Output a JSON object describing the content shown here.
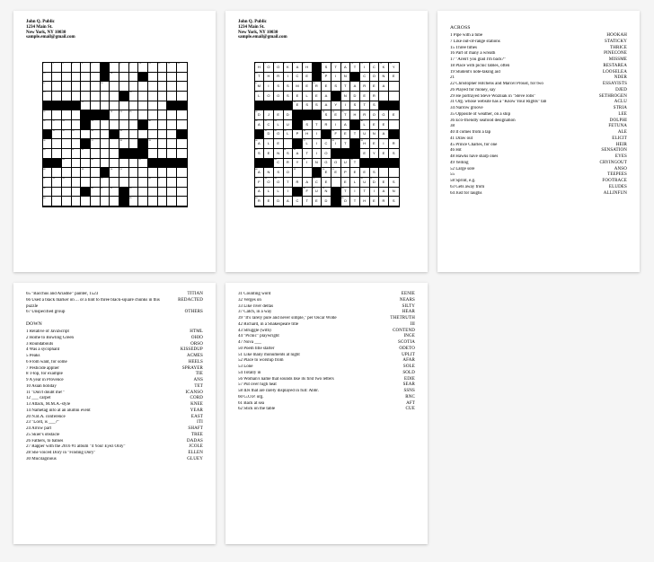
{
  "header": {
    "name": "John Q. Public",
    "street": "1234 Main St.",
    "city": "New York, NY 10030",
    "email": "sample.email@gmail.com"
  },
  "sections": {
    "across": "ACROSS",
    "down": "DOWN"
  },
  "across": [
    {
      "n": "1",
      "t": "Pipe with a tube",
      "a": "HOOKAH"
    },
    {
      "n": "7",
      "t": "Like out-of-range stations",
      "a": "STATICKY"
    },
    {
      "n": "15",
      "t": "Three times",
      "a": "THRICE"
    },
    {
      "n": "16",
      "t": "Part of many a wreath",
      "a": "PINECONE"
    },
    {
      "n": "17",
      "t": "\"Aren't you glad I'm back?\"",
      "a": "MISSME"
    },
    {
      "n": "18",
      "t": "Place with picnic tables, often",
      "a": "RESTAREA"
    },
    {
      "n": "19",
      "t": "Student's note-taking aid",
      "a": "LOOSELEA"
    },
    {
      "n": "21",
      "t": "",
      "a": "NDER"
    },
    {
      "n": "22",
      "t": "Christopher Hitchens and Marcel Proust, for two",
      "a": "ESSAYISTS"
    },
    {
      "n": "26",
      "t": "Played for money, say",
      "a": "DJED"
    },
    {
      "n": "29",
      "t": "He portrayed Steve Wozniak in \"Steve Jobs\"",
      "a": "SETHROGEN"
    },
    {
      "n": "31",
      "t": "Org. whose website has a \"Know Your Rights\" tab",
      "a": "ACLU"
    },
    {
      "n": "34",
      "t": "Narrow groove",
      "a": "STRIA"
    },
    {
      "n": "35",
      "t": "Opposite of weather, on a ship",
      "a": "LEE"
    },
    {
      "n": "36",
      "t": "Eco-friendly seafood designation",
      "a": "DOLPHI"
    },
    {
      "n": "38",
      "t": "",
      "a": "FETUNA"
    },
    {
      "n": "40",
      "t": "It comes from a tap",
      "a": "ALE"
    },
    {
      "n": "41",
      "t": "Draw out",
      "a": "ELICIT"
    },
    {
      "n": "45",
      "t": "Prince Charles, for one",
      "a": "HEIR"
    },
    {
      "n": "46",
      "t": "Hit",
      "a": "SENSATION"
    },
    {
      "n": "48",
      "t": "Hawks have sharp ones",
      "a": "EYES"
    },
    {
      "n": "49",
      "t": "Yelling",
      "a": "CRYINGOUT"
    },
    {
      "n": "52",
      "t": "Large sore",
      "a": "ANSO"
    },
    {
      "n": "55",
      "t": "",
      "a": "TEEPEES"
    },
    {
      "n": "58",
      "t": "Sprint, e.g.",
      "a": "FOOTRACE"
    },
    {
      "n": "63",
      "t": "Gets away from",
      "a": "ELUDES"
    },
    {
      "n": "64",
      "t": "Just for laughs",
      "a": "ALLINFUN"
    }
  ],
  "across2": [
    {
      "n": "65",
      "t": "\"Bacchus and Ariadne\" painter, 1523",
      "a": "TITIAN"
    },
    {
      "n": "66",
      "t": "Used a black marker on ... or a hint to three black-square chunks in this puzzle",
      "a": "REDACTED"
    },
    {
      "n": "67",
      "t": "Unspecified group",
      "a": "OTHERS"
    }
  ],
  "down": [
    {
      "n": "1",
      "t": "Relative of JavaScript",
      "a": "HTML"
    },
    {
      "n": "2",
      "t": "Home to Bowling Green",
      "a": "OHIO"
    },
    {
      "n": "3",
      "t": "Roundabouts",
      "a": "ORSO"
    },
    {
      "n": "4",
      "t": "Was a sycophant",
      "a": "KISSEDUP"
    },
    {
      "n": "5",
      "t": "Peaks",
      "a": "ACMES"
    },
    {
      "n": "6",
      "t": "From want, for some",
      "a": "HEELS"
    },
    {
      "n": "7",
      "t": "Pesticide applier",
      "a": "SPRAYER"
    },
    {
      "n": "8",
      "t": "T-top, for example",
      "a": "TIE"
    },
    {
      "n": "9",
      "t": "A year in Provence",
      "a": "ANS"
    },
    {
      "n": "10",
      "t": "Asian holiday",
      "a": "TET"
    },
    {
      "n": "11",
      "t": "\"Don't doubt me!\"",
      "a": "ICANSO"
    },
    {
      "n": "12",
      "t": "___ carpet",
      "a": "CORD"
    },
    {
      "n": "13",
      "t": "Attack, M.M.A.-style",
      "a": "KNEE"
    },
    {
      "n": "14",
      "t": "Nametag info at an alumni event",
      "a": "YEAR"
    },
    {
      "n": "20",
      "t": "N.B.A. conference",
      "a": "EAST"
    },
    {
      "n": "23",
      "t": "\"Lord, is ___?\"",
      "a": "ITI"
    },
    {
      "n": "24",
      "t": "Arrow part",
      "a": "SHAFT"
    },
    {
      "n": "25",
      "t": "Skier's obstacle",
      "a": "TREE"
    },
    {
      "n": "26",
      "t": "Fathers, to babies",
      "a": "DADAS"
    },
    {
      "n": "27",
      "t": "Rapper with the 2016 #1 album \"4 Your Eyez Only\"",
      "a": "JCOLE"
    },
    {
      "n": "28",
      "t": "She voiced Dory in \"Finding Dory\"",
      "a": "ELLEN"
    },
    {
      "n": "30",
      "t": "Mucilaginous",
      "a": "GLUEY"
    }
  ],
  "down2": [
    {
      "n": "31",
      "t": "Counting word",
      "a": "EENIE"
    },
    {
      "n": "32",
      "t": "Verges on",
      "a": "NEARS"
    },
    {
      "n": "33",
      "t": "Like river deltas",
      "a": "SILTY"
    },
    {
      "n": "37",
      "t": "Catch, in a way",
      "a": "HEAR"
    },
    {
      "n": "39",
      "t": "\"It's rarely pure and never simple,\" per Oscar Wilde",
      "a": "THETRUTH"
    },
    {
      "n": "42",
      "t": "Richard, in a Shakespeare title",
      "a": "III"
    },
    {
      "n": "43",
      "t": "Struggle (with)",
      "a": "CONTEND"
    },
    {
      "n": "44",
      "t": "\"Picnic\" playwright",
      "a": "INGE"
    },
    {
      "n": "47",
      "t": "Nova ___",
      "a": "SCOTIA"
    },
    {
      "n": "50",
      "t": "Poem title starter",
      "a": "ODETO"
    },
    {
      "n": "51",
      "t": "Like many monuments at night",
      "a": "UPLIT"
    },
    {
      "n": "52",
      "t": "Place to worship from",
      "a": "AFAR"
    },
    {
      "n": "53",
      "t": "Lone",
      "a": "SOLE"
    },
    {
      "n": "54",
      "t": "Totally in",
      "a": "SOLD"
    },
    {
      "n": "56",
      "t": "Woman's name that sounds like its first two letters",
      "a": "EDIE"
    },
    {
      "n": "57",
      "t": "Put over high heat",
      "a": "SEAR"
    },
    {
      "n": "58",
      "t": "IDs that are rarely displayed in full: Abbr.",
      "a": "SSNS"
    },
    {
      "n": "60",
      "t": "G.O.P. org.",
      "a": "RNC"
    },
    {
      "n": "61",
      "t": "Back at sea",
      "a": "AFT"
    },
    {
      "n": "62",
      "t": "Stick on the table",
      "a": "CUE"
    }
  ],
  "grid": {
    "blocks": [
      [
        0,
        6
      ],
      [
        1,
        6
      ],
      [
        1,
        10
      ],
      [
        3,
        8
      ],
      [
        4,
        0
      ],
      [
        4,
        1
      ],
      [
        4,
        2
      ],
      [
        4,
        3
      ],
      [
        4,
        13
      ],
      [
        4,
        14
      ],
      [
        5,
        4
      ],
      [
        5,
        5
      ],
      [
        5,
        6
      ],
      [
        6,
        4
      ],
      [
        6,
        10
      ],
      [
        7,
        0
      ],
      [
        7,
        7
      ],
      [
        7,
        14
      ],
      [
        8,
        4
      ],
      [
        8,
        10
      ],
      [
        9,
        8
      ],
      [
        9,
        9
      ],
      [
        9,
        10
      ],
      [
        10,
        0
      ],
      [
        10,
        1
      ],
      [
        10,
        11
      ],
      [
        10,
        12
      ],
      [
        10,
        13
      ],
      [
        10,
        14
      ],
      [
        11,
        6
      ],
      [
        13,
        4
      ],
      [
        13,
        8
      ],
      [
        14,
        8
      ]
    ],
    "numbers": {
      "0,0": "1",
      "0,1": "2",
      "0,2": "3",
      "0,3": "4",
      "0,4": "5",
      "0,5": "6",
      "0,7": "7",
      "0,8": "8",
      "0,9": "9",
      "0,10": "10",
      "0,11": "11",
      "0,12": "12",
      "0,13": "13",
      "0,14": "14",
      "1,0": "15",
      "1,7": "16",
      "2,0": "17",
      "2,6": "18",
      "3,0": "19",
      "3,9": "20",
      "4,4": "21",
      "5,0": "22",
      "5,7": "23",
      "5,8": "24",
      "5,9": "25",
      "6,0": "26",
      "6,1": "27",
      "6,2": "28",
      "6,5": "29",
      "6,11": "30",
      "7,1": "31",
      "7,2": "32",
      "7,3": "33",
      "7,5": "34",
      "7,8": "35",
      "8,0": "36",
      "8,5": "37",
      "8,8": "38",
      "8,11": "39",
      "9,0": "40",
      "9,3": "41",
      "9,4": "42",
      "9,9": "43",
      "9,10": "44",
      "10,2": "45",
      "10,5": "46",
      "10,10": "47",
      "11,0": "48",
      "11,4": "49",
      "11,7": "50",
      "11,8": "51",
      "12,0": "52",
      "12,1": "53",
      "12,2": "54",
      "12,6": "55",
      "12,11": "56",
      "12,12": "57",
      "13,0": "58",
      "13,5": "60",
      "13,6": "61",
      "13,7": "62",
      "13,9": "63",
      "14,0": "64",
      "14,9": "65"
    },
    "fill": [
      "HOOKAH.STATICKY",
      "THRICE.PIN.CONE",
      "MISSMERESTAREA.",
      "LOOSELEA.NDER..",
      "....ESSAYISTS..",
      "DJED...SETHROGE",
      "ACLU.STRIA.LEE.",
      ".DOLPHI.FETUNA.",
      "ALE.ELICIT.HEIR",
      "SENSATIO...EYES",
      "..CRYINGOUT....",
      "ANSO..TEEPEES..",
      "FOOTRACE.ELUDES",
      "ALLI.FUN.TITIAN",
      "REDACTED.OTHERS"
    ]
  }
}
